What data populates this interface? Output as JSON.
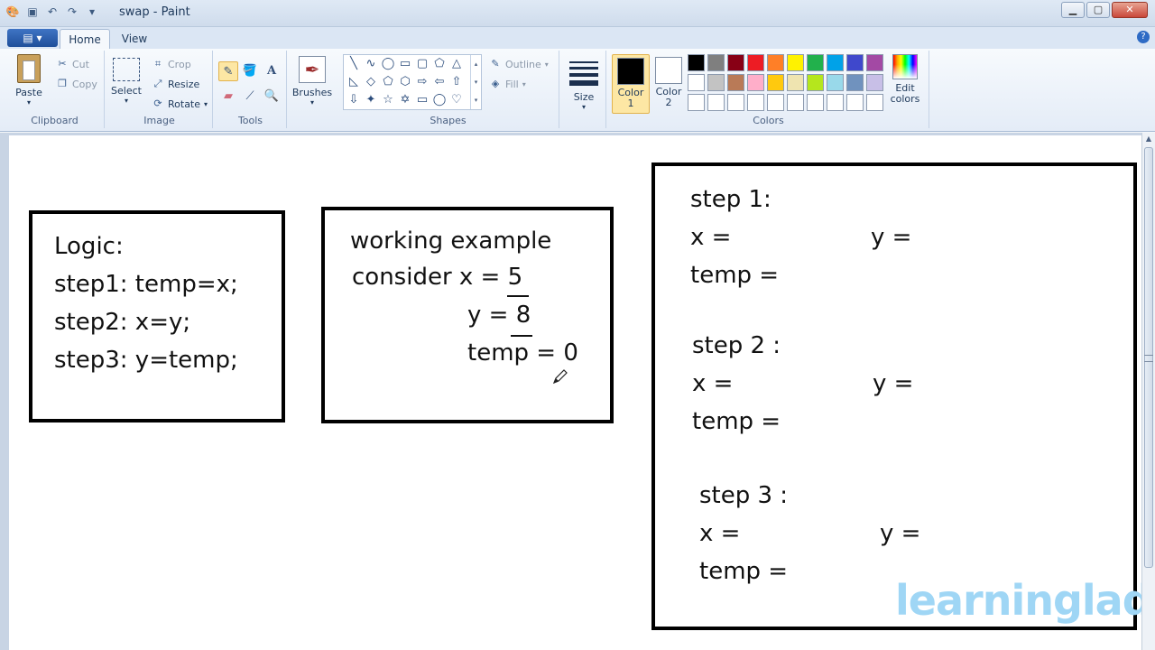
{
  "window": {
    "title": "swap - Paint",
    "min_icon": "minimize-icon",
    "max_icon": "maximize-icon",
    "close_icon": "close-icon"
  },
  "tabs": {
    "home": "Home",
    "view": "View"
  },
  "clipboard": {
    "paste": "Paste",
    "cut": "Cut",
    "copy": "Copy",
    "label": "Clipboard"
  },
  "image": {
    "select": "Select",
    "crop": "Crop",
    "resize": "Resize",
    "rotate": "Rotate",
    "label": "Image"
  },
  "tools": {
    "label": "Tools"
  },
  "brushes": {
    "label": "Brushes"
  },
  "shapes": {
    "outline": "Outline",
    "fill": "Fill",
    "label": "Shapes"
  },
  "size": {
    "label": "Size"
  },
  "colors": {
    "color1_line1": "Color",
    "color1_line2": "1",
    "color2_line1": "Color",
    "color2_line2": "2",
    "edit_line1": "Edit",
    "edit_line2": "colors",
    "label": "Colors",
    "color1_value": "#000000",
    "color2_value": "#ffffff",
    "palette": [
      "#000000",
      "#7f7f7f",
      "#880015",
      "#ed1c24",
      "#ff7f27",
      "#fff200",
      "#22b14c",
      "#00a2e8",
      "#3f48cc",
      "#a349a4",
      "#ffffff",
      "#c3c3c3",
      "#b97a57",
      "#ffaec9",
      "#ffc90e",
      "#efe4b0",
      "#b5e61d",
      "#99d9ea",
      "#7092be",
      "#c8bfe7",
      "#ffffff",
      "#ffffff",
      "#ffffff",
      "#ffffff",
      "#ffffff",
      "#ffffff",
      "#ffffff",
      "#ffffff",
      "#ffffff",
      "#ffffff"
    ]
  },
  "canvas": {
    "logic_box": {
      "line1": "Logic:",
      "line2": "step1: temp=x;",
      "line3": "step2: x=y;",
      "line4": "step3: y=temp;"
    },
    "example_box": {
      "line1": "working example",
      "line2a": "consider x = ",
      "x_val": "5",
      "line3a": "y = ",
      "y_val": "8",
      "line4": "temp = 0"
    },
    "steps_box": {
      "s1": "step 1:",
      "s1_x": "x =",
      "s1_y": "y =",
      "s1_temp": "temp =",
      "s2": "step 2 :",
      "s2_x": "x =",
      "s2_y": "y =",
      "s2_temp": "temp =",
      "s3": "step 3 :",
      "s3_x": "x =",
      "s3_y": "y =",
      "s3_temp": "temp ="
    },
    "watermark": "learninglad"
  }
}
